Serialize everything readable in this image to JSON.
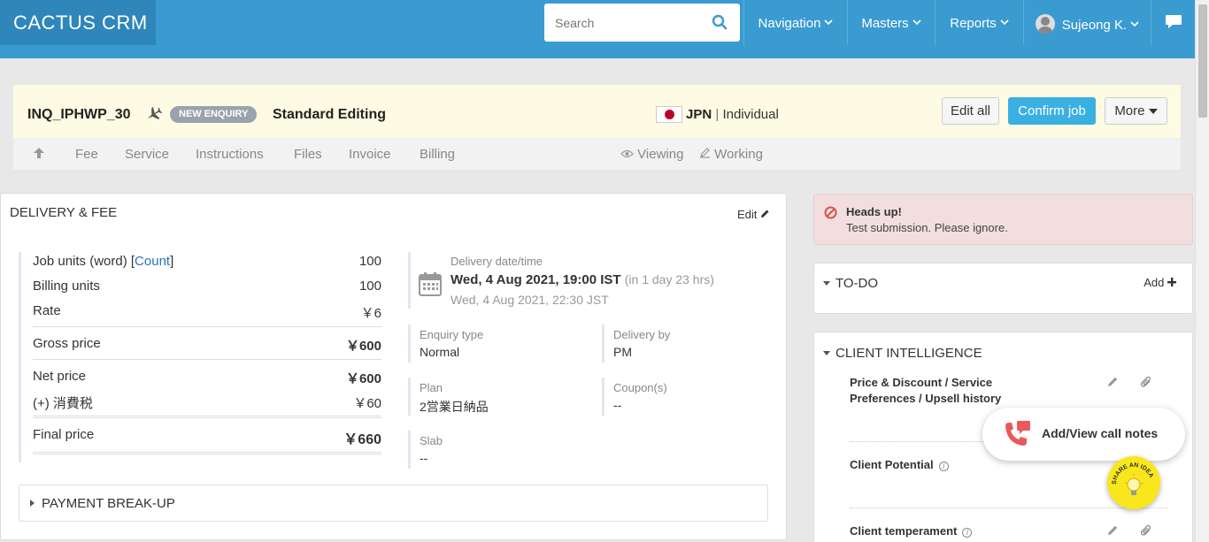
{
  "app": {
    "name": "CACTUS CRM"
  },
  "search": {
    "placeholder": "Search"
  },
  "nav": {
    "navigation": "Navigation",
    "masters": "Masters",
    "reports": "Reports",
    "user": "Sujeong K."
  },
  "job": {
    "id": "INQ_IPHWP_30",
    "status_badge": "NEW ENQUIRY",
    "service": "Standard Editing",
    "country": "JPN",
    "separator": "|",
    "client_type": "Individual",
    "buttons": {
      "edit_all": "Edit all",
      "confirm": "Confirm job",
      "more": "More"
    }
  },
  "tabs": [
    "Fee",
    "Service",
    "Instructions",
    "Files",
    "Invoice",
    "Billing"
  ],
  "presence": {
    "viewing": "Viewing",
    "working": "Working"
  },
  "delivery": {
    "title": "DELIVERY & FEE",
    "edit": "Edit",
    "job_units_label": "Job units (word) [",
    "count_link": "Count",
    "job_units_close": "]",
    "job_units": "100",
    "billing_units_label": "Billing units",
    "billing_units": "100",
    "rate_label": "Rate",
    "rate": "￥6",
    "gross_label": "Gross price",
    "gross": "￥600",
    "net_label": "Net price",
    "net": "￥600",
    "tax_label": "(+) 消費税",
    "tax": "￥60",
    "final_label": "Final price",
    "final": "￥660",
    "delivery_dt_label": "Delivery date/time",
    "delivery_dt": "Wed, 4 Aug 2021, 19:00 IST",
    "delivery_rel": "(in 1 day 23 hrs)",
    "delivery_local": "Wed, 4 Aug 2021, 22:30 JST",
    "enquiry_type_label": "Enquiry type",
    "enquiry_type": "Normal",
    "delivery_by_label": "Delivery by",
    "delivery_by": "PM",
    "plan_label": "Plan",
    "plan": "2営業日納品",
    "coupon_label": "Coupon(s)",
    "coupon": "--",
    "slab_label": "Slab",
    "slab": "--",
    "payment_breakup": "PAYMENT BREAK-UP"
  },
  "alert": {
    "title": "Heads up!",
    "message": "Test submission. Please ignore."
  },
  "todo": {
    "title": "TO-DO",
    "add": "Add"
  },
  "client_intel": {
    "title": "CLIENT INTELLIGENCE",
    "items": [
      "Price & Discount / Service Preferences / Upsell history",
      "Client Potential",
      "Client temperament"
    ]
  },
  "call_notes": "Add/View call notes",
  "idea_badge": "SHARE AN IDEA",
  "colors": {
    "topbar": "#3a9bd0",
    "logo_bg": "#2e86bb",
    "primary_button": "#3ab0e2",
    "alert_bg": "#f2dede",
    "alert_icon": "#d9534f",
    "idea": "#f8e71c"
  }
}
